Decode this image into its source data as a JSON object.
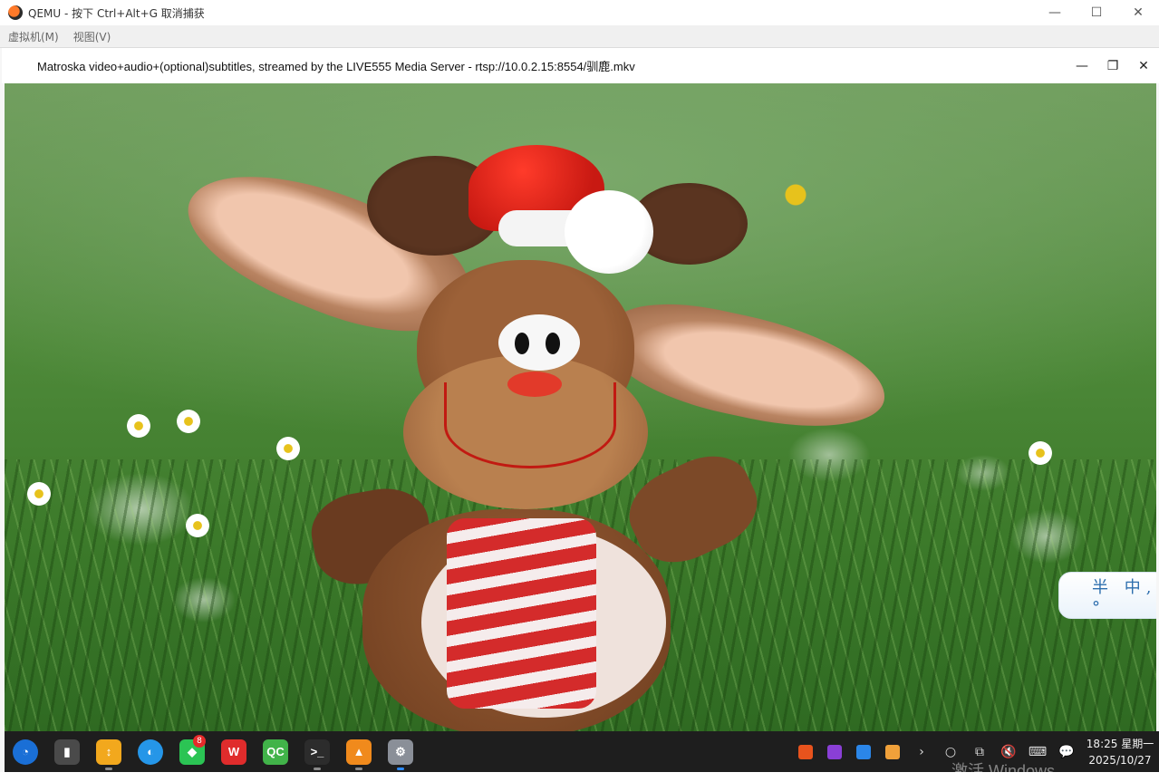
{
  "qemu": {
    "title": "QEMU - 按下 Ctrl+Alt+G 取消捕获",
    "menu": [
      "虚拟机(M)",
      "视图(V)"
    ],
    "controls": {
      "minimize": "—",
      "maximize": "☐",
      "close": "✕"
    }
  },
  "player": {
    "title": "Matroska video+audio+(optional)subtitles, streamed by the LIVE555 Media Server - rtsp://10.0.2.15:8554/驯鹿.mkv",
    "controls": {
      "minimize": "—",
      "restore": "❐",
      "close": "✕"
    }
  },
  "video": {
    "subtitle_bubble": "半 中,°"
  },
  "taskbar": {
    "apps": [
      {
        "name": "launcher",
        "icon": "deepin-launcher-icon",
        "label": "◔",
        "color": "#1a6fd6"
      },
      {
        "name": "multitask-view",
        "icon": "multitask-view-icon",
        "label": "▮",
        "color": "#4a4a4a"
      },
      {
        "name": "app-store",
        "icon": "app-store-icon",
        "label": "↕",
        "color": "#f2a81d"
      },
      {
        "name": "browser",
        "icon": "browser-icon",
        "label": "◐",
        "color": "#2596e8"
      },
      {
        "name": "wechat",
        "icon": "wechat-icon",
        "label": "◆",
        "color": "#2bc454",
        "badge": "8"
      },
      {
        "name": "wps",
        "icon": "wps-icon",
        "label": "W",
        "color": "#e02c2c"
      },
      {
        "name": "qt-creator",
        "icon": "qt-creator-icon",
        "label": "QC",
        "color": "#41b349"
      },
      {
        "name": "terminal",
        "icon": "terminal-icon",
        "label": ">_",
        "color": "#2c2c2c"
      },
      {
        "name": "vlc",
        "icon": "vlc-icon",
        "label": "▲",
        "color": "#f08a1c"
      },
      {
        "name": "settings",
        "icon": "settings-icon",
        "label": "⚙",
        "color": "#8a8f98"
      }
    ],
    "tray": [
      {
        "name": "tray-app-1",
        "icon": "colorful-app-icon",
        "color": "#e8531d"
      },
      {
        "name": "tray-app-2",
        "icon": "camera-app-icon",
        "color": "#8a3fd6"
      },
      {
        "name": "tray-app-3",
        "icon": "feishu-icon",
        "color": "#2b86e8"
      },
      {
        "name": "tray-app-4",
        "icon": "mail-app-icon",
        "color": "#f0a13a"
      }
    ],
    "tray_glyphs": {
      "expand": "›",
      "search": "○",
      "screen": "⧉",
      "volume": "🔇",
      "keyboard": "⌨",
      "notify": "💬"
    },
    "clock": {
      "time": "18:25 星期一",
      "date": "2025/10/27"
    }
  },
  "watermark": "激活 Windows"
}
